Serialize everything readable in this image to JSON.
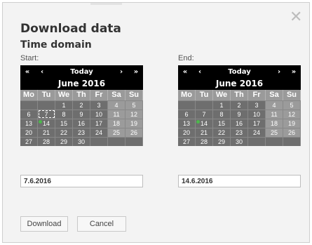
{
  "dialog": {
    "title": "Download data",
    "subtitle": "Time domain",
    "close_icon": "close-icon"
  },
  "start": {
    "label": "Start:",
    "nav": {
      "first": "«",
      "prev": "‹",
      "today": "Today",
      "next": "›",
      "last": "»"
    },
    "month": "June 2016",
    "input_value": "7.6.2016"
  },
  "end": {
    "label": "End:",
    "nav": {
      "first": "«",
      "prev": "‹",
      "today": "Today",
      "next": "›",
      "last": "»"
    },
    "month": "June 2016",
    "input_value": "14.6.2016"
  },
  "weekdays": [
    "Mo",
    "Tu",
    "We",
    "Th",
    "Fr",
    "Sa",
    "Su"
  ],
  "weeks": [
    [
      "",
      "",
      "1",
      "2",
      "3",
      "4",
      "5"
    ],
    [
      "6",
      "7",
      "8",
      "9",
      "10",
      "11",
      "12"
    ],
    [
      "13",
      "14",
      "15",
      "16",
      "17",
      "18",
      "19"
    ],
    [
      "20",
      "21",
      "22",
      "23",
      "24",
      "25",
      "26"
    ],
    [
      "27",
      "28",
      "29",
      "30",
      "",
      "",
      ""
    ]
  ],
  "today_day": "14",
  "start_selected_day": "7",
  "buttons": {
    "download": "Download",
    "cancel": "Cancel"
  },
  "colors": {
    "calendar_bg": "#000000",
    "day_cell": "#6e6e6e",
    "weekday_header": "#9a9a9a",
    "today_marker": "#4cb84c"
  }
}
